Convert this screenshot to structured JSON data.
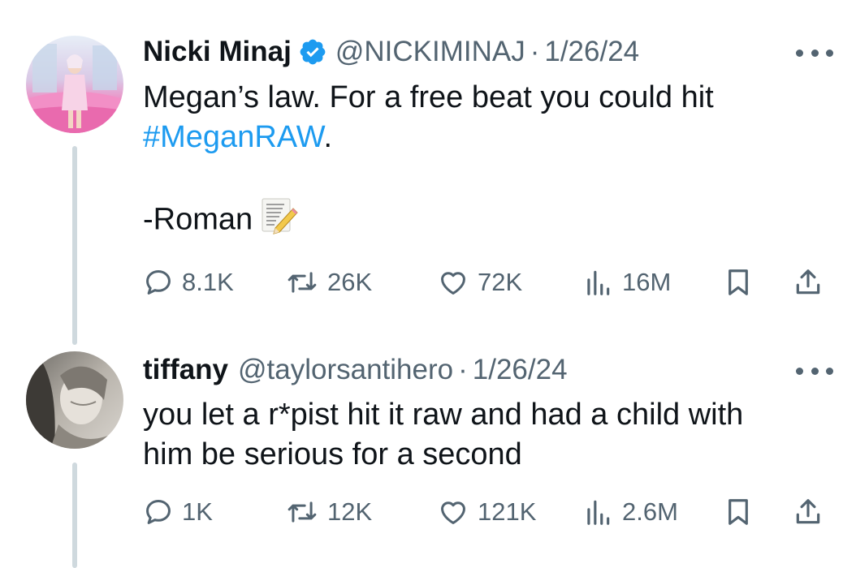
{
  "tweets": [
    {
      "author_name": "Nicki Minaj",
      "handle": "@NICKIMINAJ",
      "separator": "·",
      "date": "1/26/24",
      "text_line1": "Megan’s law. For a free beat you could hit",
      "hashtag": "#MeganRAW",
      "text_after_hashtag": ".",
      "signature": "-Roman",
      "signature_emoji": "memo-icon",
      "verified": true,
      "replies": "8.1K",
      "reposts": "26K",
      "likes": "72K",
      "views": "16M"
    },
    {
      "author_name": "tiffany",
      "handle": "@taylorsantihero",
      "separator": "·",
      "date": "1/26/24",
      "text_line1": "you let a r*pist hit it raw and had a child with",
      "text_line2": "him be serious for a second",
      "verified": false,
      "replies": "1K",
      "reposts": "12K",
      "likes": "121K",
      "views": "2.6M"
    }
  ],
  "colors": {
    "text": "#0f1419",
    "secondary": "#536471",
    "link": "#1d9bf0",
    "thread_line": "#cfd9de"
  }
}
